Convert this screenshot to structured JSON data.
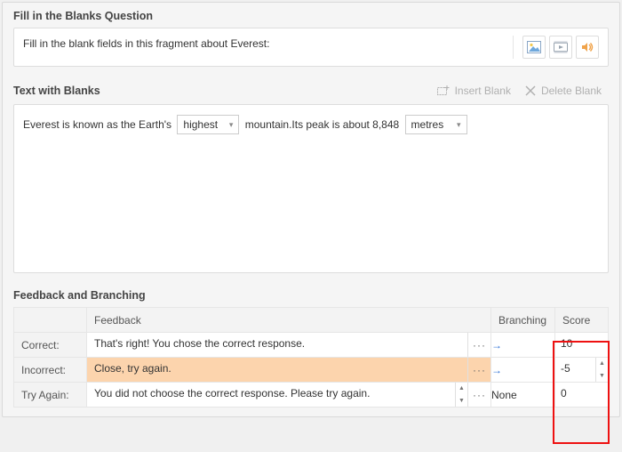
{
  "question": {
    "section_title": "Fill in the Blanks Question",
    "prompt": "Fill in the blank fields in this fragment about Everest:"
  },
  "blanks": {
    "section_title": "Text with Blanks",
    "insert_label": "Insert Blank",
    "delete_label": "Delete Blank",
    "pre1": "Everest is known as the Earth's",
    "blank1": "highest",
    "mid": "mountain.Its peak is about 8,848",
    "blank2": "metres"
  },
  "feedback": {
    "section_title": "Feedback and Branching",
    "headers": {
      "feedback": "Feedback",
      "branching": "Branching",
      "score": "Score"
    },
    "rows": {
      "correct": {
        "label": "Correct:",
        "text": "That's right! You chose the correct response.",
        "branching": "arrow",
        "score": "10"
      },
      "incorrect": {
        "label": "Incorrect:",
        "text": "Close, try again.",
        "branching": "arrow",
        "score": "-5"
      },
      "tryagain": {
        "label": "Try Again:",
        "text": "You did not choose the correct response. Please try again.",
        "branching": "None",
        "score": "0"
      }
    }
  },
  "icons": {
    "image": "image-icon",
    "video": "video-icon",
    "audio": "audio-icon"
  }
}
